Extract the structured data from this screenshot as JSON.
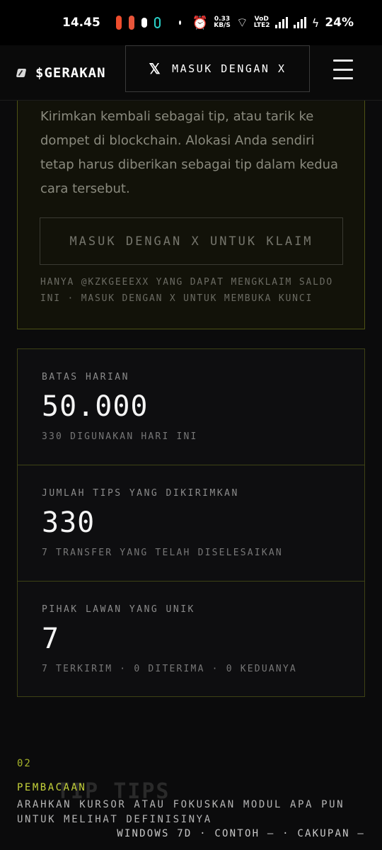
{
  "status_bar": {
    "time": "14.45",
    "app_icons": [
      "shopee-icon",
      "game-icon",
      "chat-icon",
      "store-icon"
    ],
    "speed_value": "0.33",
    "speed_unit": "KB/S",
    "volte": "VoD LTE2",
    "battery": "24%"
  },
  "header": {
    "brand": "$GERAKAN",
    "login_label": "MASUK DENGAN X",
    "x_glyph": "𝕏"
  },
  "claim": {
    "description": "Kirimkan kembali sebagai tip, atau tarik ke dompet di blockchain. Alokasi Anda sendiri tetap harus diberikan sebagai tip dalam kedua cara tersebut.",
    "button_label": "MASUK DENGAN X UNTUK KLAIM",
    "note": "HANYA @KZKGEEEXX YANG DAPAT MENGKLAIM SALDO INI · MASUK DENGAN X UNTUK MEMBUKA KUNCI"
  },
  "stats": [
    {
      "label": "BATAS HARIAN",
      "value": "50.000",
      "sub": "330 DIGUNAKAN HARI INI"
    },
    {
      "label": "JUMLAH TIPS YANG DIKIRIMKAN",
      "value": "330",
      "sub": "7 TRANSFER YANG TELAH DISELESAIKAN"
    },
    {
      "label": "PIHAK LAWAN YANG UNIK",
      "value": "7",
      "sub": "7 TERKIRIM · 0 DITERIMA · 0 KEDUANYA"
    }
  ],
  "section": {
    "number": "02",
    "ghost_title": "TIP TIPS"
  },
  "reading": {
    "label": "PEMBACAAN",
    "text": "ARAHKAN KURSOR ATAU FOKUSKAN MODUL APA PUN UNTUK MELIHAT DEFINISINYA",
    "footer": "WINDOWS 7D · CONTOH — · CAKUPAN —"
  },
  "colors": {
    "accent": "#c6d33a",
    "card_border": "#4d5215",
    "background": "#0b0b0c"
  }
}
